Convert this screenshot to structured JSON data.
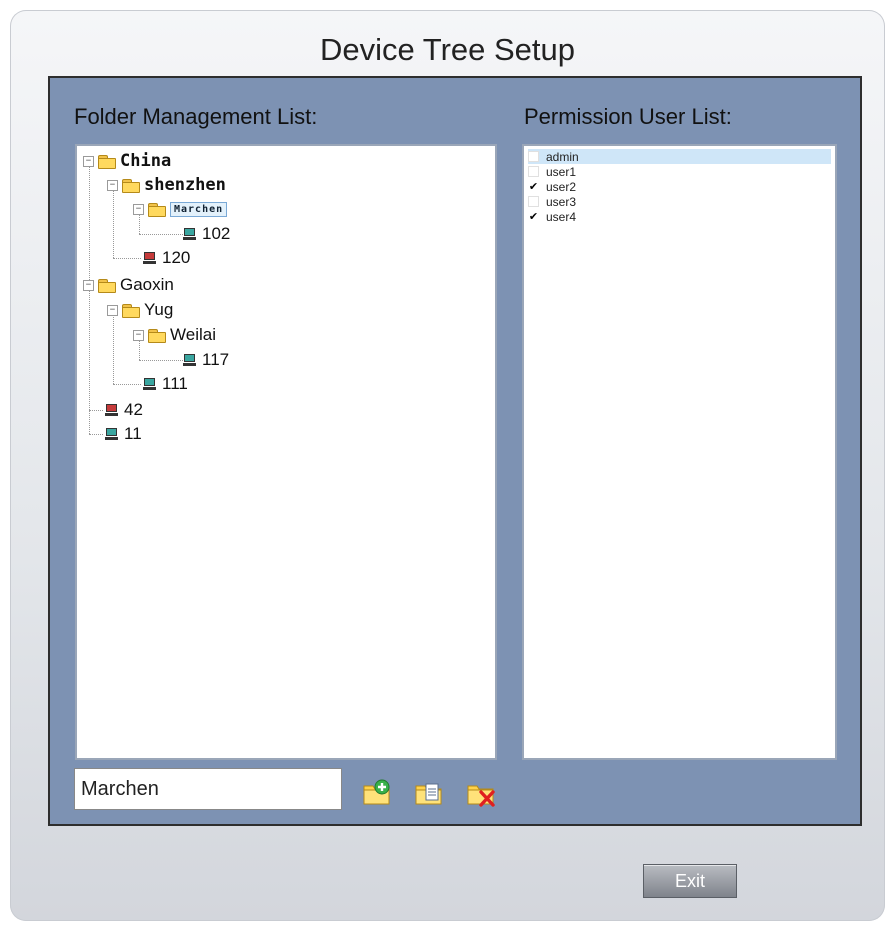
{
  "window": {
    "title": "Device Tree Setup"
  },
  "folder_panel": {
    "label": "Folder Management List:"
  },
  "user_panel": {
    "label": "Permission User List:"
  },
  "tree": [
    {
      "label": "China",
      "type": "folder",
      "expanded": true,
      "style": "mono"
    },
    {
      "label": "shenzhen",
      "type": "folder",
      "expanded": true,
      "style": "mono"
    },
    {
      "label": "Marchen",
      "type": "folder",
      "expanded": true,
      "selected": true
    },
    {
      "label": "102",
      "type": "device",
      "status": "online"
    },
    {
      "label": "120",
      "type": "device",
      "status": "offline"
    },
    {
      "label": "Gaoxin",
      "type": "folder",
      "expanded": true
    },
    {
      "label": "Yug",
      "type": "folder",
      "expanded": true
    },
    {
      "label": "Weilai",
      "type": "folder",
      "expanded": true
    },
    {
      "label": "117",
      "type": "device",
      "status": "online"
    },
    {
      "label": "111",
      "type": "device",
      "status": "online"
    },
    {
      "label": "42",
      "type": "device",
      "status": "offline"
    },
    {
      "label": "11",
      "type": "device",
      "status": "online"
    }
  ],
  "users": [
    {
      "name": "admin",
      "checked": false
    },
    {
      "name": "user1",
      "checked": false
    },
    {
      "name": "user2",
      "checked": true
    },
    {
      "name": "user3",
      "checked": false
    },
    {
      "name": "user4",
      "checked": true
    }
  ],
  "folder_name_input": {
    "value": "Marchen"
  },
  "toolbar": {
    "add_icon": "add-folder-icon",
    "edit_icon": "edit-folder-icon",
    "delete_icon": "delete-folder-icon"
  },
  "exit_button": {
    "label": "Exit"
  },
  "colors": {
    "panel_bg": "#7d92b3",
    "device_online": "#3aa6a0",
    "device_offline": "#c63b3b",
    "selection": "#cfe6f8"
  }
}
